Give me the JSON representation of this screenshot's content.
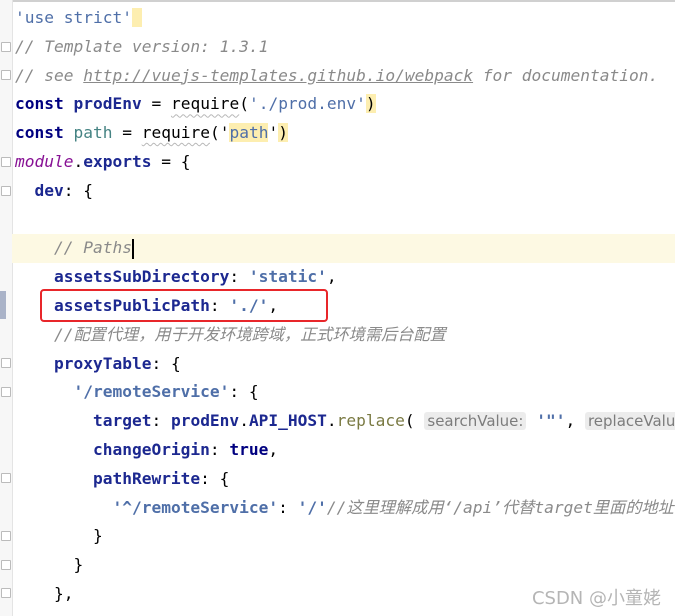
{
  "editor": {
    "current_line": 9,
    "highlighted_line": 11,
    "lines": [
      [
        {
          "t": "'use strict'",
          "c": "str"
        },
        {
          "t": " ",
          "c": "hl"
        }
      ],
      [
        {
          "t": "// Template version: 1.3.1",
          "c": "cm"
        }
      ],
      [
        {
          "t": "// see ",
          "c": "cm"
        },
        {
          "t": "http://vuejs-templates.github.io/webpack",
          "c": "link"
        },
        {
          "t": " for documentation.",
          "c": "cm"
        }
      ],
      [
        {
          "t": "const",
          "c": "kw"
        },
        {
          "t": " ",
          "c": "plain"
        },
        {
          "t": "prodEnv",
          "c": "prop"
        },
        {
          "t": " = ",
          "c": "plain"
        },
        {
          "t": "require",
          "c": "fn"
        },
        {
          "t": "(",
          "c": "plain"
        },
        {
          "t": "'./prod.env'",
          "c": "str"
        },
        {
          "t": ")",
          "c": "plain hl"
        }
      ],
      [
        {
          "t": "const",
          "c": "kw"
        },
        {
          "t": " ",
          "c": "plain"
        },
        {
          "t": "path",
          "c": "var"
        },
        {
          "t": " = ",
          "c": "plain"
        },
        {
          "t": "require",
          "c": "fn"
        },
        {
          "t": "('",
          "c": "plain"
        },
        {
          "t": "path",
          "c": "str hl"
        },
        {
          "t": "'",
          "c": "plain"
        },
        {
          "t": ")",
          "c": "plain hl"
        }
      ],
      [
        {
          "t": "module",
          "c": "mod"
        },
        {
          "t": ".",
          "c": "plain"
        },
        {
          "t": "exports",
          "c": "prop"
        },
        {
          "t": " = {",
          "c": "plain"
        }
      ],
      [
        {
          "t": "  ",
          "c": "plain"
        },
        {
          "t": "dev",
          "c": "prop"
        },
        {
          "t": ": {",
          "c": "plain"
        }
      ],
      [
        {
          "t": "",
          "c": "plain"
        }
      ],
      [
        {
          "t": "    ",
          "c": "plain"
        },
        {
          "t": "// Paths",
          "c": "cm"
        }
      ],
      [
        {
          "t": "    ",
          "c": "plain"
        },
        {
          "t": "assetsSubDirectory",
          "c": "prop"
        },
        {
          "t": ": ",
          "c": "plain"
        },
        {
          "t": "'static'",
          "c": "strb"
        },
        {
          "t": ",",
          "c": "plain"
        }
      ],
      [
        {
          "t": "    ",
          "c": "plain"
        },
        {
          "t": "assetsPublicPath",
          "c": "prop"
        },
        {
          "t": ": ",
          "c": "plain"
        },
        {
          "t": "'./'",
          "c": "strb"
        },
        {
          "t": ",",
          "c": "plain"
        }
      ],
      [
        {
          "t": "    ",
          "c": "plain"
        },
        {
          "t": "//配置代理，用于开发环境跨域，正式环境需后台配置",
          "c": "cm"
        }
      ],
      [
        {
          "t": "    ",
          "c": "plain"
        },
        {
          "t": "proxyTable",
          "c": "prop"
        },
        {
          "t": ": {",
          "c": "plain"
        }
      ],
      [
        {
          "t": "      ",
          "c": "plain"
        },
        {
          "t": "'/remoteService'",
          "c": "strb"
        },
        {
          "t": ": {",
          "c": "plain"
        }
      ],
      [
        {
          "t": "        ",
          "c": "plain"
        },
        {
          "t": "target",
          "c": "prop"
        },
        {
          "t": ": ",
          "c": "plain"
        },
        {
          "t": "prodEnv",
          "c": "prop"
        },
        {
          "t": ".",
          "c": "plain"
        },
        {
          "t": "API_HOST",
          "c": "prop"
        },
        {
          "t": ".",
          "c": "plain"
        },
        {
          "t": "replace",
          "c": "meth"
        },
        {
          "t": "( ",
          "c": "plain"
        },
        {
          "t": "searchValue:",
          "c": "hint"
        },
        {
          "t": " '\"'",
          "c": "strb"
        },
        {
          "t": ", ",
          "c": "plain"
        },
        {
          "t": "replaceValue:",
          "c": "hint"
        }
      ],
      [
        {
          "t": "        ",
          "c": "plain"
        },
        {
          "t": "changeOrigin",
          "c": "prop"
        },
        {
          "t": ": ",
          "c": "plain"
        },
        {
          "t": "true",
          "c": "kw"
        },
        {
          "t": ",",
          "c": "plain"
        }
      ],
      [
        {
          "t": "        ",
          "c": "plain"
        },
        {
          "t": "pathRewrite",
          "c": "prop"
        },
        {
          "t": ": {",
          "c": "plain"
        }
      ],
      [
        {
          "t": "          ",
          "c": "plain"
        },
        {
          "t": "'^/remoteService'",
          "c": "strb"
        },
        {
          "t": ": ",
          "c": "plain"
        },
        {
          "t": "'/'",
          "c": "strb"
        },
        {
          "t": "//这里理解成用‘/api’代替target里面的地址",
          "c": "cm"
        }
      ],
      [
        {
          "t": "        }",
          "c": "plain"
        }
      ],
      [
        {
          "t": "      }",
          "c": "plain"
        }
      ],
      [
        {
          "t": "    },",
          "c": "plain"
        }
      ]
    ]
  },
  "watermark": "CSDN @小童姥",
  "colors": {
    "highlight_box": "#e8262a",
    "current_line_bg": "#fdf9e3"
  }
}
